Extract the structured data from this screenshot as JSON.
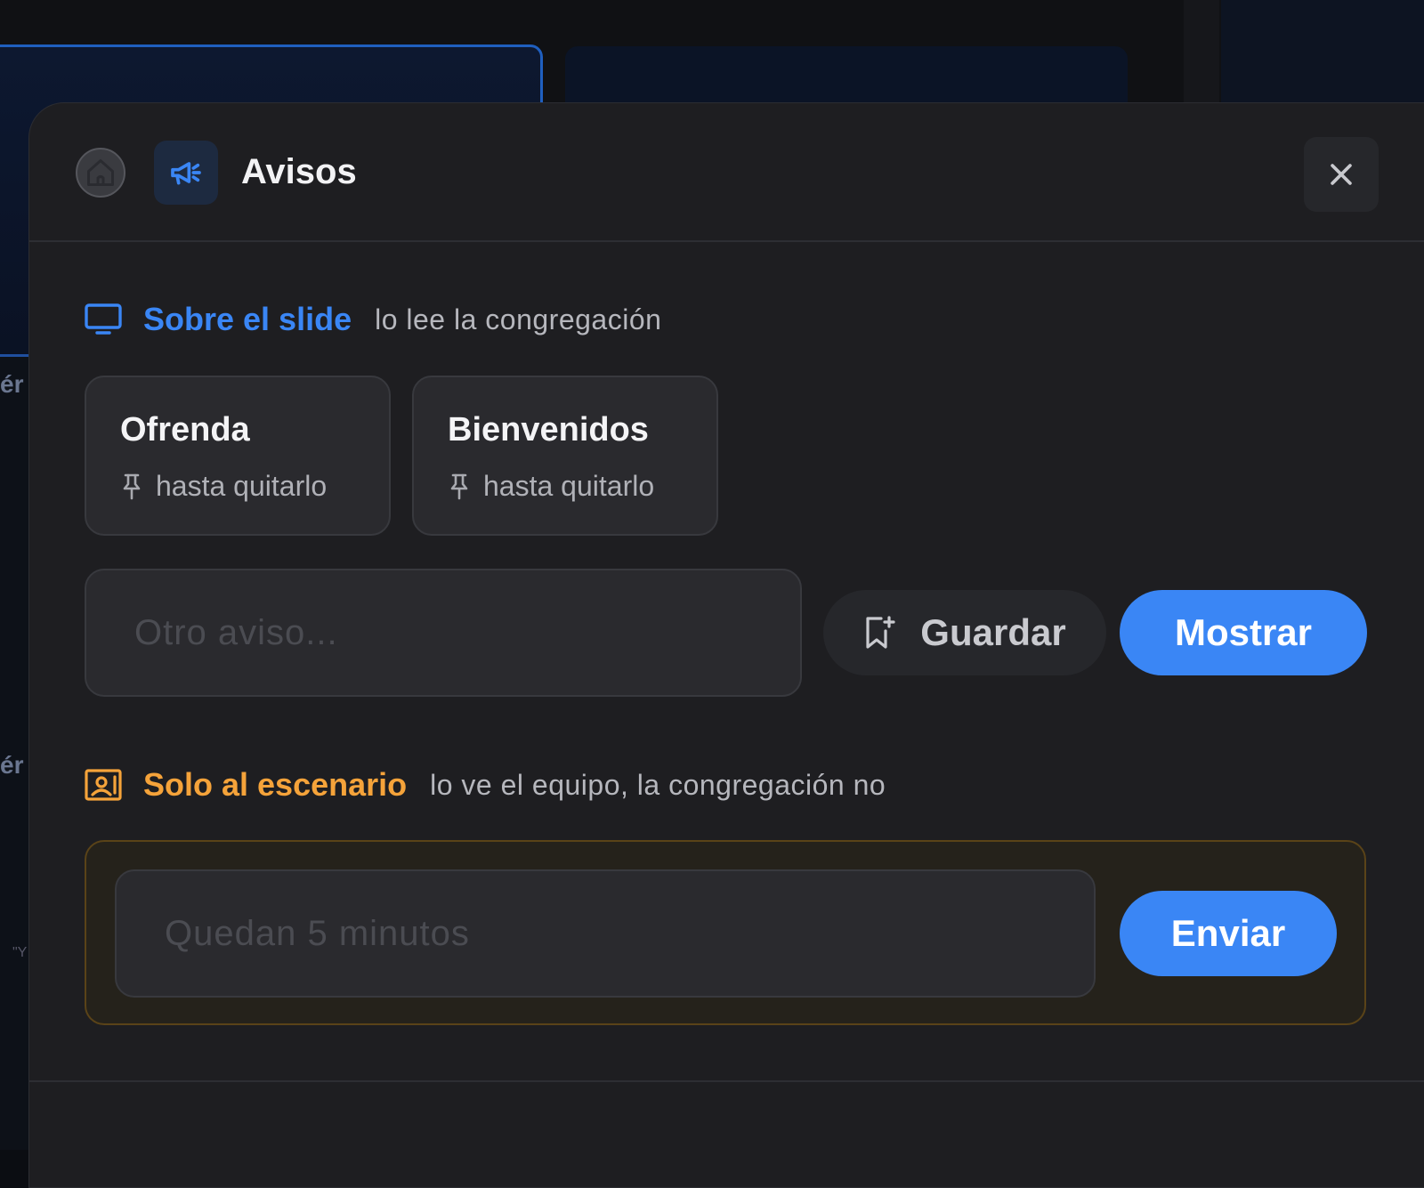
{
  "background": {
    "fragments": [
      "ér",
      "ér",
      "\"Y"
    ]
  },
  "header": {
    "title": "Avisos",
    "home_icon": "home-icon",
    "section_icon": "megaphone-icon",
    "close_icon": "close-icon"
  },
  "slide_section": {
    "title": "Sobre el slide",
    "subtitle": "lo lee la congregación",
    "icon": "monitor-icon",
    "accent": "#3a86f5",
    "presets": [
      {
        "label": "Ofrenda",
        "duration": "hasta quitarlo"
      },
      {
        "label": "Bienvenidos",
        "duration": "hasta quitarlo"
      }
    ],
    "input_placeholder": "Otro aviso...",
    "save_label": "Guardar",
    "show_label": "Mostrar"
  },
  "stage_section": {
    "title": "Solo al escenario",
    "subtitle": "lo ve el equipo, la congregación no",
    "icon": "stage-monitor-icon",
    "accent": "#f5a33a",
    "input_placeholder": "Quedan 5 minutos",
    "send_label": "Enviar"
  }
}
